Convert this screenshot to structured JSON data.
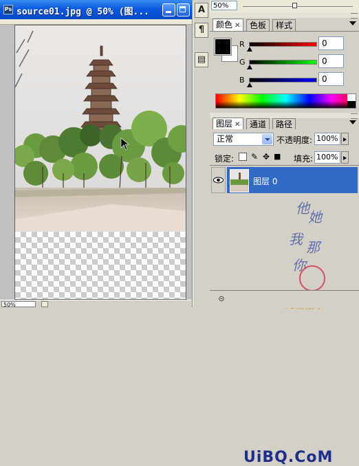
{
  "document": {
    "title": "source01.jpg @ 50% (图...",
    "zoom": "50%"
  },
  "toolstrip": {
    "icons": [
      "character-icon",
      "paragraph-icon",
      "notes-icon"
    ],
    "labels": [
      "A",
      "¶",
      "▤"
    ]
  },
  "top_bar": {
    "opacity_value": "50%"
  },
  "color_panel": {
    "tabs": [
      "颜色",
      "色板",
      "样式"
    ],
    "channels": [
      {
        "name": "R",
        "value": "0",
        "color": "#c00000"
      },
      {
        "name": "G",
        "value": "0",
        "color": "#00a000"
      },
      {
        "name": "B",
        "value": "0",
        "color": "#0000c0"
      }
    ],
    "foreground": "#000000",
    "background": "#ffffff"
  },
  "layers_panel": {
    "tabs": [
      "图层",
      "通道",
      "路径"
    ],
    "blend_mode": "正常",
    "opacity_label": "不透明度:",
    "opacity_value": "100%",
    "lock_label": "锁定:",
    "fill_label": "填充:",
    "fill_value": "100%",
    "layers": [
      {
        "name": "图层 0",
        "selected": true,
        "visible": true
      }
    ]
  },
  "watermark": {
    "handwriting": "他她我那你",
    "seal": "印",
    "ps_text": "PS教程网"
  },
  "brand": {
    "text": "UiBQ.CoM"
  }
}
